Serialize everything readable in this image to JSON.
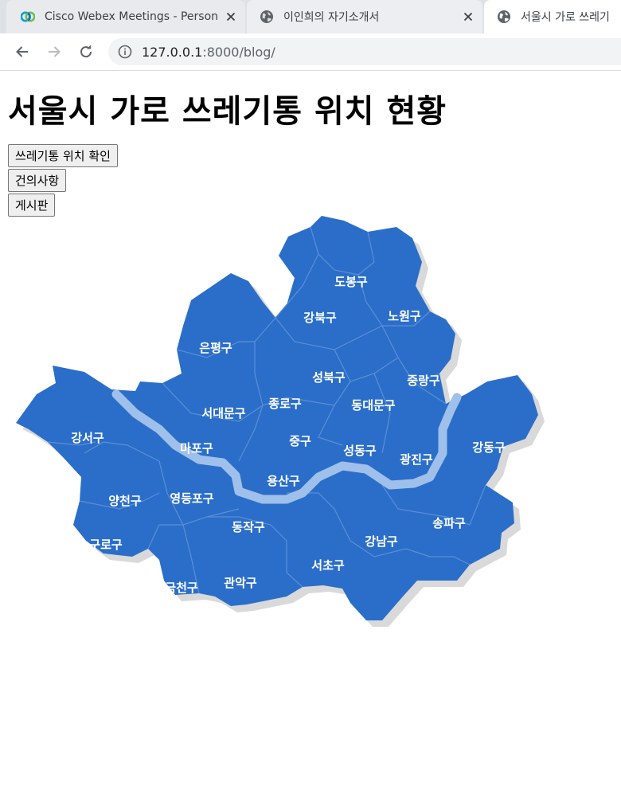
{
  "tabs": [
    {
      "title": "Cisco Webex Meetings - Person",
      "icon": "webex-icon",
      "close": "close-icon"
    },
    {
      "title": "이인희의 자기소개서",
      "icon": "globe-icon",
      "close": "close-icon"
    },
    {
      "title": "서울시 가로 쓰레기",
      "icon": "globe-icon"
    }
  ],
  "toolbar": {
    "url_host": "127.0.0.1",
    "url_path": ":8000/blog/"
  },
  "page": {
    "title": "서울시 가로 쓰레기통 위치 현황",
    "buttons": [
      "쓰레기통 위치 확인",
      "건의사항",
      "게시판"
    ]
  },
  "map": {
    "fill_color": "#2b6ec9",
    "shadow_color": "#d9d9d9",
    "river_color": "#9fc0ea",
    "districts": [
      "도봉구",
      "강북구",
      "노원구",
      "은평구",
      "성북구",
      "중랑구",
      "종로구",
      "동대문구",
      "서대문구",
      "강서구",
      "마포구",
      "중구",
      "성동구",
      "광진구",
      "강동구",
      "용산구",
      "양천구",
      "영등포구",
      "동작구",
      "송파구",
      "구로구",
      "강남구",
      "서초구",
      "관악구",
      "금천구"
    ]
  }
}
